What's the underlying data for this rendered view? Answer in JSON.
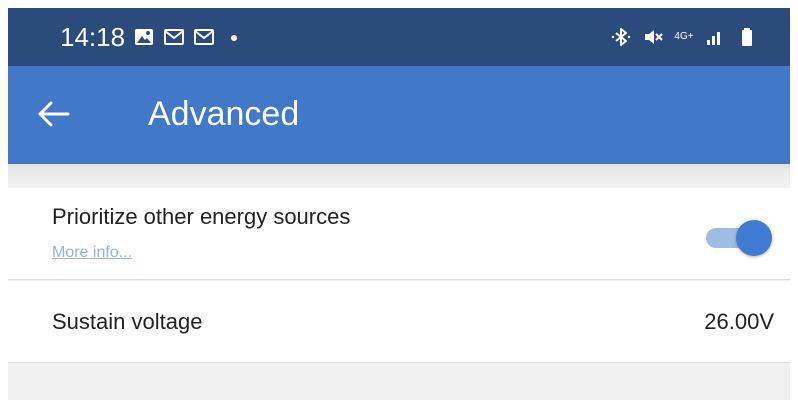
{
  "status_bar": {
    "time": "14:18",
    "left_icons": [
      "gallery-icon",
      "gmail-icon",
      "gmail-icon",
      "notification-dot-icon"
    ],
    "right_icons": [
      "bluetooth-icon",
      "mute-icon",
      "network-4g-icon",
      "signal-icon",
      "battery-icon"
    ],
    "network_label": "4G+",
    "background": "#2b4b7d"
  },
  "app_bar": {
    "title": "Advanced",
    "background": "#4178c8",
    "back_icon": "back-arrow-icon"
  },
  "settings": {
    "prioritize": {
      "label": "Prioritize other energy sources",
      "link": "More info...",
      "enabled": true
    },
    "sustain": {
      "label": "Sustain voltage",
      "value": "26.00V"
    }
  },
  "colors": {
    "accent": "#3f7ad3",
    "toggle_track": "#9ebde6",
    "link": "#8fb4e6"
  }
}
